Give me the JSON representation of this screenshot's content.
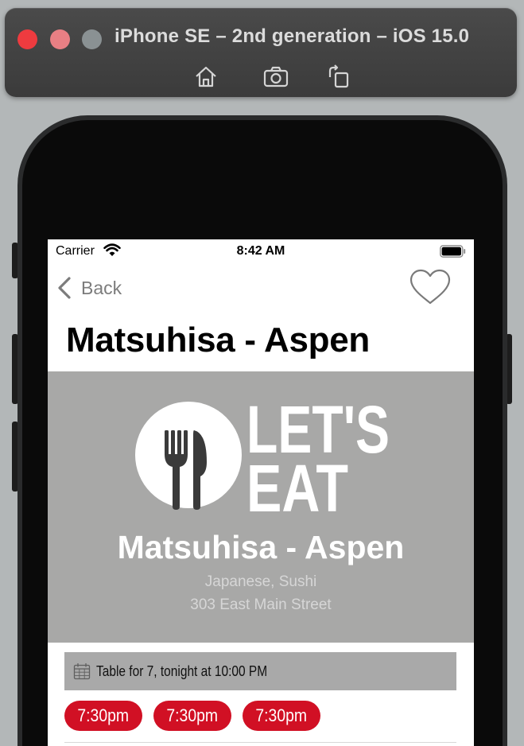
{
  "simulator": {
    "title": "iPhone SE – 2nd generation – iOS 15.0",
    "toolbar": [
      {
        "name": "home-icon"
      },
      {
        "name": "screenshot-icon"
      },
      {
        "name": "rotate-icon"
      }
    ]
  },
  "status_bar": {
    "carrier": "Carrier",
    "time": "8:42 AM"
  },
  "nav": {
    "back_label": "Back"
  },
  "page": {
    "title": "Matsuhisa - Aspen"
  },
  "hero": {
    "logo_text_line1": "LET'S",
    "logo_text_line2": "EAT",
    "restaurant_name": "Matsuhisa - Aspen",
    "cuisine": "Japanese, Sushi",
    "address": "303 East Main Street"
  },
  "reservation": {
    "label": "Table for 7, tonight at 10:00 PM"
  },
  "time_slots": [
    "7:30pm",
    "7:30pm",
    "7:30pm"
  ],
  "colors": {
    "accent_red": "#d11024",
    "hero_bg": "#a8a8a7",
    "reservation_bg": "#a9a9a9"
  }
}
